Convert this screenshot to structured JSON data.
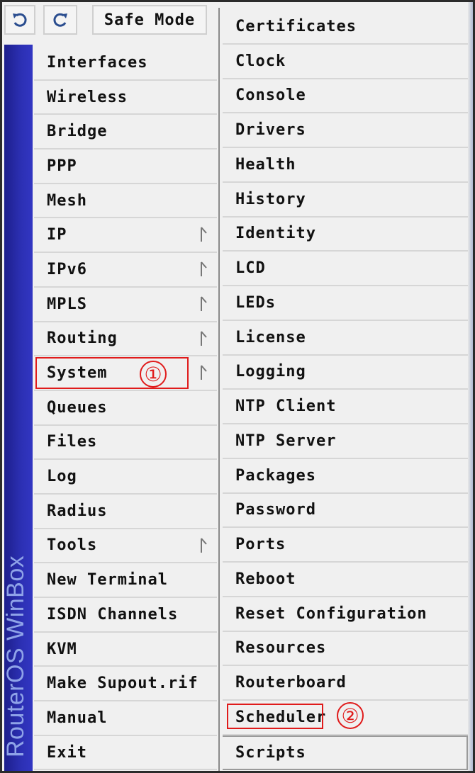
{
  "toolbar": {
    "undo_icon": "undo-icon",
    "redo_icon": "redo-icon",
    "safe_mode_label": "Safe Mode"
  },
  "brand": {
    "text": "RouterOS WinBox"
  },
  "main_menu": {
    "items": [
      {
        "label": "Interfaces",
        "submenu": false
      },
      {
        "label": "Wireless",
        "submenu": false
      },
      {
        "label": "Bridge",
        "submenu": false
      },
      {
        "label": "PPP",
        "submenu": false
      },
      {
        "label": "Mesh",
        "submenu": false
      },
      {
        "label": "IP",
        "submenu": true
      },
      {
        "label": "IPv6",
        "submenu": true
      },
      {
        "label": "MPLS",
        "submenu": true
      },
      {
        "label": "Routing",
        "submenu": true
      },
      {
        "label": "System",
        "submenu": true,
        "selected": true
      },
      {
        "label": "Queues",
        "submenu": false
      },
      {
        "label": "Files",
        "submenu": false
      },
      {
        "label": "Log",
        "submenu": false
      },
      {
        "label": "Radius",
        "submenu": false
      },
      {
        "label": "Tools",
        "submenu": true
      },
      {
        "label": "New Terminal",
        "submenu": false
      },
      {
        "label": "ISDN Channels",
        "submenu": false
      },
      {
        "label": "KVM",
        "submenu": false
      },
      {
        "label": "Make Supout.rif",
        "submenu": false
      },
      {
        "label": "Manual",
        "submenu": false
      },
      {
        "label": "Exit",
        "submenu": false
      }
    ]
  },
  "system_submenu": {
    "items": [
      "Certificates",
      "Clock",
      "Console",
      "Drivers",
      "Health",
      "History",
      "Identity",
      "LCD",
      "LEDs",
      "License",
      "Logging",
      "NTP Client",
      "NTP Server",
      "Packages",
      "Password",
      "Ports",
      "Reboot",
      "Reset Configuration",
      "Resources",
      "Routerboard",
      "Scheduler",
      "Scripts"
    ]
  },
  "annotations": {
    "marker_1": "①",
    "marker_2": "②"
  },
  "colors": {
    "highlight": "#e01b1b",
    "brand_bar": "#2c30b4",
    "brand_text": "#8fa3e8"
  }
}
